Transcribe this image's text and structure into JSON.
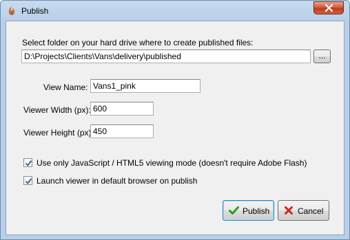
{
  "window": {
    "title": "Publish"
  },
  "folder": {
    "label": "Select folder on your hard drive where to create published files:",
    "path": "D:\\Projects\\Clients\\Vans\\delivery\\published",
    "browse_label": "..."
  },
  "fields": {
    "view_name_label": "View Name:",
    "view_name_value": "Vans1_pink",
    "width_label": "Viewer Width (px):",
    "width_value": "600",
    "height_label": "Viewer Height (px):",
    "height_value": "450"
  },
  "options": {
    "js_mode_label": "Use only JavaScript / HTML5 viewing mode (doesn't require Adobe Flash)",
    "js_mode_checked": true,
    "launch_label": "Launch viewer in default browser on publish",
    "launch_checked": true
  },
  "buttons": {
    "publish_label": "Publish",
    "cancel_label": "Cancel"
  },
  "colors": {
    "check_icon": "#2a9b1c",
    "cancel_icon": "#d0231b"
  }
}
